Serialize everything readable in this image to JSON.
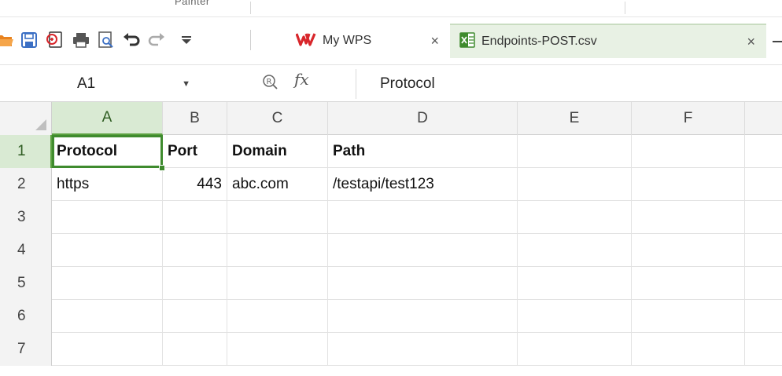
{
  "ribbon": {
    "remnant_label": "Painter"
  },
  "tabs": [
    {
      "label": "My WPS",
      "icon": "wps-logo-icon",
      "close": "×",
      "active": false
    },
    {
      "label": "Endpoints-POST.csv",
      "icon": "spreadsheet-file-icon",
      "close": "×",
      "active": true
    }
  ],
  "formula_bar": {
    "name_box": "A1",
    "formula": "Protocol"
  },
  "columns": [
    "A",
    "B",
    "C",
    "D",
    "E",
    "F"
  ],
  "rows": [
    {
      "num": "1",
      "cells": [
        "Protocol",
        "Port",
        "Domain",
        "Path",
        "",
        ""
      ]
    },
    {
      "num": "2",
      "cells": [
        "https",
        "443",
        "abc.com",
        "/testapi/test123",
        "",
        ""
      ]
    },
    {
      "num": "3",
      "cells": [
        "",
        "",
        "",
        "",
        "",
        ""
      ]
    },
    {
      "num": "4",
      "cells": [
        "",
        "",
        "",
        "",
        "",
        ""
      ]
    },
    {
      "num": "5",
      "cells": [
        "",
        "",
        "",
        "",
        "",
        ""
      ]
    },
    {
      "num": "6",
      "cells": [
        "",
        "",
        "",
        "",
        "",
        ""
      ]
    },
    {
      "num": "7",
      "cells": [
        "",
        "",
        "",
        "",
        "",
        ""
      ]
    }
  ],
  "selection": {
    "cell": "A1",
    "accent": "#3f8b2e",
    "header_highlight": "#d9ead3"
  },
  "colors": {
    "wps_red": "#d8262b",
    "save_blue": "#3b6fc4",
    "open_orange": "#e8821f"
  }
}
